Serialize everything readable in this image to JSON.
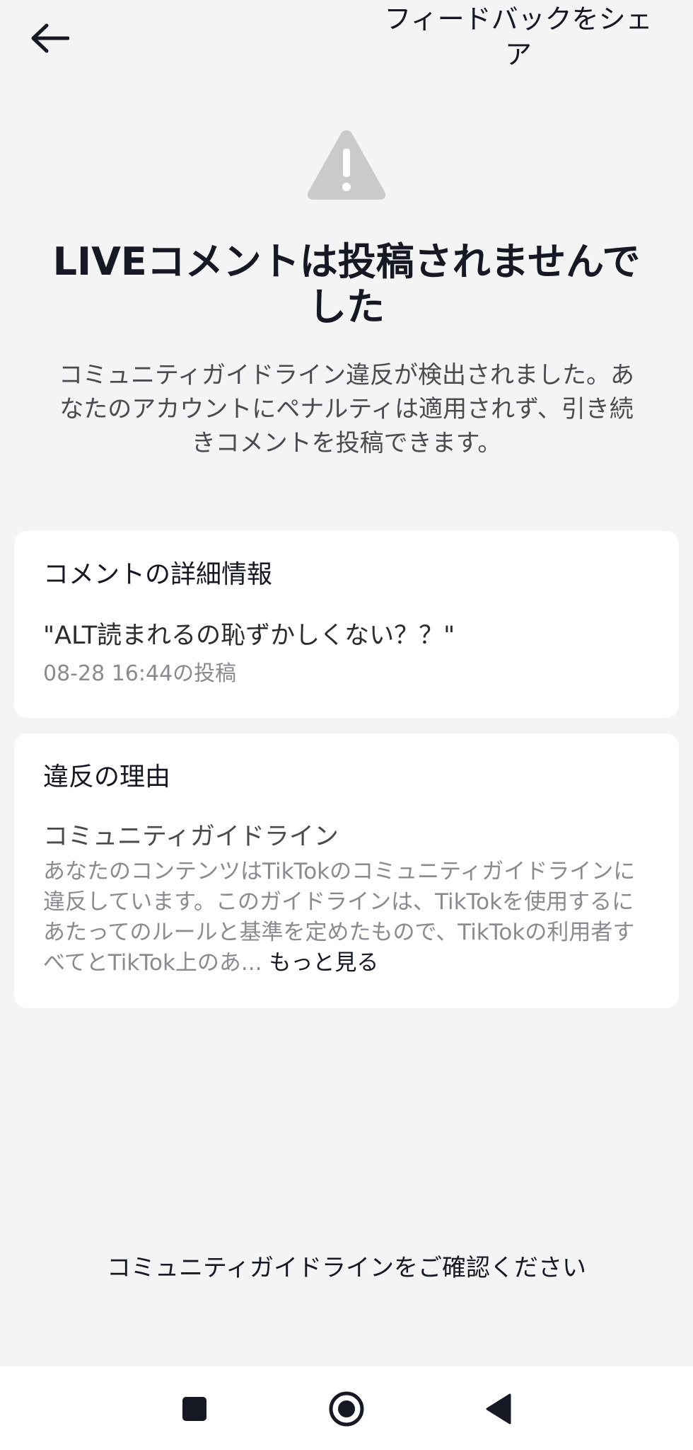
{
  "header": {
    "back_icon": "arrow-left-icon",
    "feedback_label": "フィードバックをシェア"
  },
  "status": {
    "icon": "warning-triangle-icon",
    "icon_color": "#cacaca",
    "headline": "LIVEコメントは投稿されませんでした",
    "description": "コミュニティガイドライン違反が検出されました。あなたのアカウントにペナルティは適用されず、引き続きコメントを投稿できます。"
  },
  "comment_details": {
    "title": "コメントの詳細情報",
    "comment": "\"ALT読まれるの恥ずかしくない？？\"",
    "posted_at": "08-28 16:44の投稿"
  },
  "violation": {
    "title": "違反の理由",
    "policy_name": "コミュニティガイドライン",
    "policy_text": "あなたのコンテンツはTikTokのコミュニティガイドラインに違反しています。このガイドラインは、TikTokを使用するにあたってのルールと基準を定めたもので、TikTokの利用者すべてとTikTok上のあ...",
    "see_more_label": "もっと見る"
  },
  "footer": {
    "guidelines_link": "コミュニティガイドラインをご確認ください"
  },
  "system_nav": {
    "recents_icon": "square-recents-icon",
    "home_icon": "circle-home-icon",
    "back_icon": "triangle-back-icon"
  }
}
